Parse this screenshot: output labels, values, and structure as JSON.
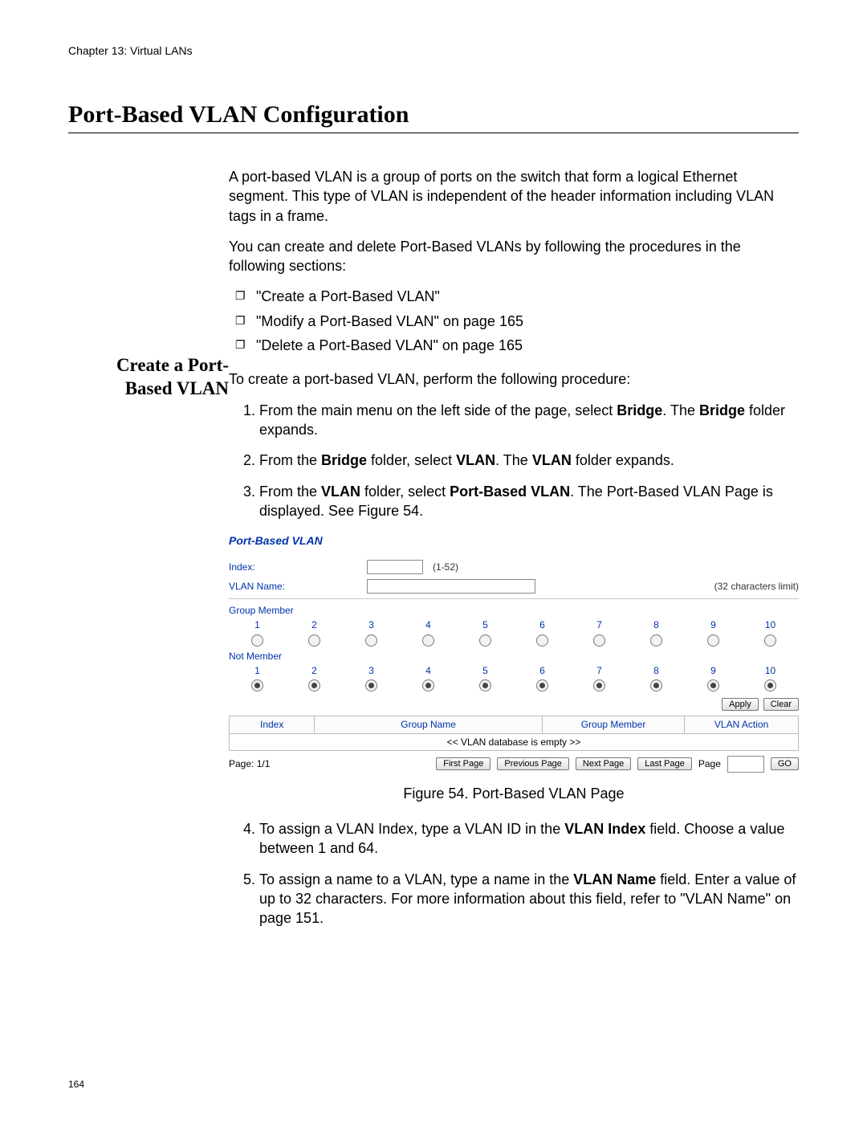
{
  "chapter": "Chapter 13: Virtual LANs",
  "title": "Port-Based VLAN Configuration",
  "page_number": "164",
  "intro1": "A port-based VLAN is a group of ports on the switch that form a logical Ethernet segment. This type of VLAN is independent of the header information including VLAN tags in a frame.",
  "intro2": "You can create and delete Port-Based VLANs by following the procedures in the following sections:",
  "bullets": [
    "\"Create a Port-Based VLAN\"",
    "\"Modify a Port-Based VLAN\" on page 165",
    "\"Delete a Port-Based VLAN\" on page 165"
  ],
  "side_heading_l1": "Create a Port-",
  "side_heading_l2": "Based VLAN",
  "lead": "To create a port-based VLAN, perform the following procedure:",
  "step1_a": "From the main menu on the left side of the page, select ",
  "step1_bold": "Bridge",
  "step1_b": ". The ",
  "step1_bold2": "Bridge",
  "step1_c": " folder expands.",
  "step2_a": "From the ",
  "step2_bold": "Bridge",
  "step2_b": " folder, select ",
  "step2_bold2": "VLAN",
  "step2_c": ". The ",
  "step2_bold3": "VLAN",
  "step2_d": " folder expands.",
  "step3_a": "From the ",
  "step3_bold": "VLAN",
  "step3_b": " folder, select ",
  "step3_bold2": "Port-Based VLAN",
  "step3_c": ". The Port-Based VLAN Page is displayed. See Figure 54.",
  "figure_caption": "Figure 54. Port-Based VLAN Page",
  "step4_a": "To assign a VLAN Index, type a VLAN ID in the ",
  "step4_bold": "VLAN Index",
  "step4_b": " field. Choose a value between 1 and 64.",
  "step5_a": "To assign a name to a VLAN, type a name in the ",
  "step5_bold": "VLAN Name",
  "step5_b": " field. Enter a value of up to 32 characters. For more information about this field, refer to \"VLAN Name\" on page 151.",
  "panel": {
    "title": "Port-Based VLAN",
    "index_label": "Index:",
    "index_hint": "(1-52)",
    "name_label": "VLAN Name:",
    "name_hint": "(32 characters limit)",
    "group_member": "Group Member",
    "not_member": "Not Member",
    "ports": [
      "1",
      "2",
      "3",
      "4",
      "5",
      "6",
      "7",
      "8",
      "9",
      "10"
    ],
    "apply": "Apply",
    "clear": "Clear",
    "th_index": "Index",
    "th_group_name": "Group Name",
    "th_group_member": "Group Member",
    "th_vlan_action": "VLAN Action",
    "empty_row": "<< VLAN database is empty >>",
    "page_label": "Page:  1/1",
    "first": "First Page",
    "prev": "Previous Page",
    "next": "Next Page",
    "last": "Last Page",
    "page_word": "Page",
    "go": "GO"
  }
}
